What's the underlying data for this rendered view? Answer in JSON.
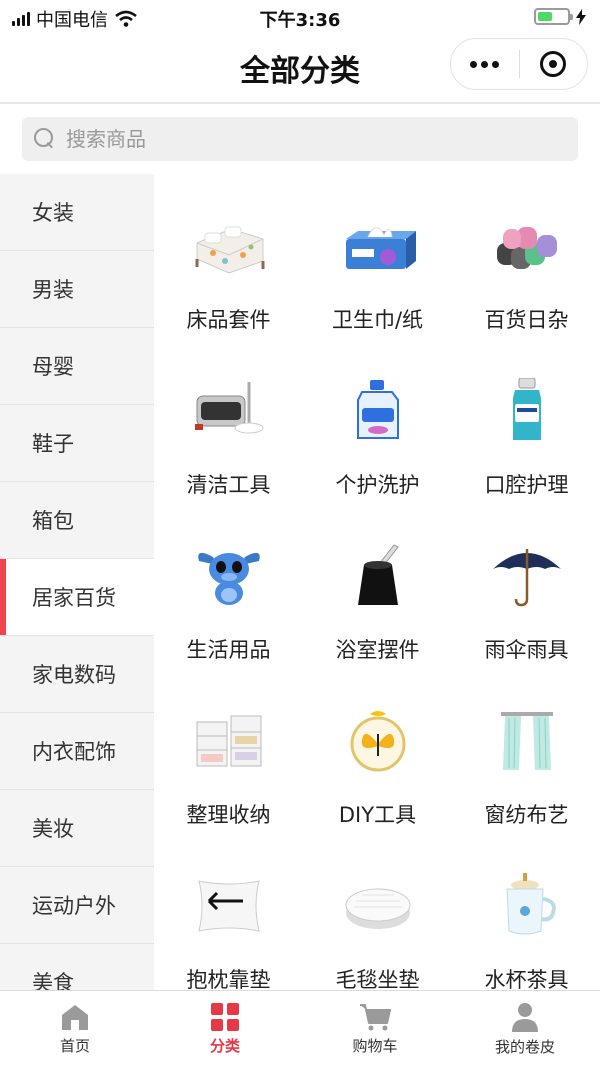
{
  "status_bar": {
    "carrier": "中国电信",
    "time": "下午3:36",
    "battery_fraction": 0.5
  },
  "nav": {
    "title": "全部分类"
  },
  "search": {
    "placeholder": "搜索商品"
  },
  "sidebar": {
    "items": [
      {
        "label": "女装"
      },
      {
        "label": "男装"
      },
      {
        "label": "母婴"
      },
      {
        "label": "鞋子"
      },
      {
        "label": "箱包"
      },
      {
        "label": "居家百货",
        "active": true
      },
      {
        "label": "家电数码"
      },
      {
        "label": "内衣配饰"
      },
      {
        "label": "美妆"
      },
      {
        "label": "运动户外"
      },
      {
        "label": "美食"
      }
    ]
  },
  "categories": [
    {
      "label": "床品套件",
      "icon": "bedding-icon"
    },
    {
      "label": "卫生巾/纸",
      "icon": "tissue-icon"
    },
    {
      "label": "百货日杂",
      "icon": "garbage-bags-icon"
    },
    {
      "label": "清洁工具",
      "icon": "mop-bucket-icon"
    },
    {
      "label": "个护洗护",
      "icon": "detergent-icon"
    },
    {
      "label": "口腔护理",
      "icon": "mouthwash-icon"
    },
    {
      "label": "生活用品",
      "icon": "plush-toy-icon"
    },
    {
      "label": "浴室摆件",
      "icon": "toilet-brush-icon"
    },
    {
      "label": "雨伞雨具",
      "icon": "umbrella-icon"
    },
    {
      "label": "整理收纳",
      "icon": "storage-drawers-icon"
    },
    {
      "label": "DIY工具",
      "icon": "embroidery-hoop-icon"
    },
    {
      "label": "窗纺布艺",
      "icon": "curtain-icon"
    },
    {
      "label": "抱枕靠垫",
      "icon": "pillow-icon"
    },
    {
      "label": "毛毯坐垫",
      "icon": "cushion-icon"
    },
    {
      "label": "水杯茶具",
      "icon": "mug-icon"
    }
  ],
  "tabbar": {
    "tabs": [
      {
        "label": "首页",
        "icon": "home-icon"
      },
      {
        "label": "分类",
        "icon": "grid-icon",
        "active": true
      },
      {
        "label": "购物车",
        "icon": "cart-icon"
      },
      {
        "label": "我的卷皮",
        "icon": "user-icon"
      }
    ]
  },
  "colors": {
    "accent": "#e63946",
    "sidebar_bg": "#f4f4f4",
    "indicator": "#f04450"
  }
}
